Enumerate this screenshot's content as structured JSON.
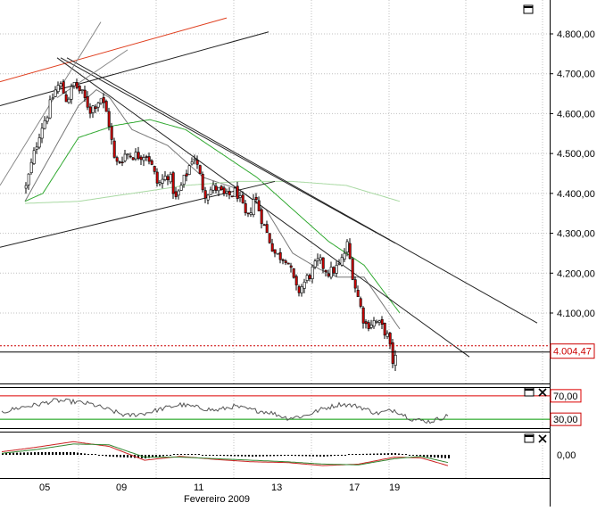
{
  "theme": {
    "grid": "#c0c0c0",
    "axis": "#000000",
    "up": "#ffffff",
    "down": "#cc0000",
    "wick": "#000000",
    "ma_fast": "#777777",
    "ma_mid": "#33aa33",
    "ma_slow": "#a9d9a3",
    "trend": "#000000",
    "trend_red": "#e04020",
    "price_line": "#cc0000",
    "rsi_line": "#555555",
    "ob_line": "#dd0000",
    "os_line": "#009900"
  },
  "chart_data": [
    {
      "type": "candlestick",
      "panel": "price",
      "xlabel": "Fevereiro 2009",
      "x_tick_labels": [
        "05",
        "09",
        "11",
        "13",
        "17",
        "19"
      ],
      "ylim": [
        4015,
        4840
      ],
      "y_tick_labels": [
        "4.100,00",
        "4.200,00",
        "4.300,00",
        "4.400,00",
        "4.500,00",
        "4.600,00",
        "4.700,00",
        "4.800,00"
      ],
      "y_ticks": [
        4100,
        4200,
        4300,
        4400,
        4500,
        4600,
        4700,
        4800
      ],
      "grid": true,
      "last_price": 4004.47,
      "last_price_label": "4.004,47",
      "close_anchors": [
        [
          0,
          4415
        ],
        [
          8,
          4490
        ],
        [
          16,
          4560
        ],
        [
          24,
          4600
        ],
        [
          32,
          4655
        ],
        [
          38,
          4675
        ],
        [
          46,
          4632
        ],
        [
          54,
          4675
        ],
        [
          62,
          4652
        ],
        [
          72,
          4610
        ],
        [
          84,
          4640
        ],
        [
          92,
          4590
        ],
        [
          100,
          4470
        ],
        [
          112,
          4500
        ],
        [
          124,
          4495
        ],
        [
          136,
          4500
        ],
        [
          148,
          4420
        ],
        [
          160,
          4450
        ],
        [
          168,
          4385
        ],
        [
          180,
          4450
        ],
        [
          188,
          4500
        ],
        [
          200,
          4400
        ],
        [
          212,
          4415
        ],
        [
          224,
          4390
        ],
        [
          236,
          4405
        ],
        [
          248,
          4330
        ],
        [
          256,
          4395
        ],
        [
          268,
          4310
        ],
        [
          280,
          4245
        ],
        [
          292,
          4240
        ],
        [
          304,
          4150
        ],
        [
          316,
          4190
        ],
        [
          328,
          4230
        ],
        [
          340,
          4200
        ],
        [
          352,
          4220
        ],
        [
          360,
          4270
        ],
        [
          368,
          4175
        ],
        [
          380,
          4070
        ],
        [
          392,
          4080
        ],
        [
          404,
          4050
        ],
        [
          412,
          3970
        ],
        [
          416,
          4004
        ]
      ],
      "moving_averages": [
        {
          "period_class": "fast",
          "anchors": [
            [
              0,
              4380
            ],
            [
              30,
              4500
            ],
            [
              60,
              4620
            ],
            [
              80,
              4660
            ],
            [
              95,
              4640
            ],
            [
              120,
              4560
            ],
            [
              160,
              4520
            ],
            [
              200,
              4440
            ],
            [
              240,
              4410
            ],
            [
              270,
              4360
            ],
            [
              300,
              4250
            ],
            [
              330,
              4210
            ],
            [
              350,
              4190
            ],
            [
              380,
              4190
            ],
            [
              420,
              4060
            ]
          ]
        },
        {
          "period_class": "mid",
          "anchors": [
            [
              0,
              4380
            ],
            [
              20,
              4400
            ],
            [
              60,
              4540
            ],
            [
              100,
              4570
            ],
            [
              140,
              4585
            ],
            [
              180,
              4560
            ],
            [
              220,
              4500
            ],
            [
              260,
              4440
            ],
            [
              300,
              4360
            ],
            [
              340,
              4280
            ],
            [
              380,
              4220
            ],
            [
              420,
              4100
            ]
          ]
        },
        {
          "period_class": "slow",
          "anchors": [
            [
              0,
              4375
            ],
            [
              60,
              4380
            ],
            [
              120,
              4400
            ],
            [
              180,
              4420
            ],
            [
              240,
              4430
            ],
            [
              300,
              4430
            ],
            [
              360,
              4420
            ],
            [
              420,
              4380
            ]
          ]
        }
      ],
      "trendlines": [
        {
          "color": "red",
          "from": [
            -28,
            4680
          ],
          "to": [
            226,
            4840
          ]
        },
        {
          "color": "black",
          "from": [
            -28,
            4620
          ],
          "to": [
            273,
            4805
          ]
        },
        {
          "color": "black",
          "from": [
            -28,
            4265
          ],
          "to": [
            280,
            4430
          ]
        },
        {
          "color": "black",
          "from": [
            47,
            4740
          ],
          "to": [
            574,
            4075
          ]
        },
        {
          "color": "black",
          "from": [
            36,
            4740
          ],
          "to": [
            498,
            3990
          ]
        },
        {
          "color": "black",
          "from": [
            40,
            4740
          ],
          "to": [
            415,
            4275
          ]
        },
        {
          "color": "grey",
          "from": [
            -28,
            4420
          ],
          "to": [
            85,
            4830
          ]
        },
        {
          "color": "grey",
          "from": [
            36,
            4640
          ],
          "to": [
            115,
            4760
          ]
        }
      ]
    },
    {
      "type": "line",
      "panel": "oscillator",
      "yticks": [
        30,
        70
      ],
      "y_tick_labels": [
        "30,00",
        "70,00"
      ],
      "ylim": [
        15,
        85
      ],
      "anchors": [
        [
          0,
          42
        ],
        [
          20,
          50
        ],
        [
          40,
          55
        ],
        [
          60,
          62
        ],
        [
          80,
          60
        ],
        [
          100,
          56
        ],
        [
          120,
          46
        ],
        [
          140,
          36
        ],
        [
          160,
          40
        ],
        [
          180,
          48
        ],
        [
          200,
          55
        ],
        [
          220,
          50
        ],
        [
          240,
          45
        ],
        [
          260,
          52
        ],
        [
          280,
          46
        ],
        [
          300,
          42
        ],
        [
          320,
          32
        ],
        [
          340,
          36
        ],
        [
          360,
          48
        ],
        [
          380,
          56
        ],
        [
          400,
          52
        ],
        [
          420,
          40
        ],
        [
          440,
          46
        ],
        [
          460,
          30
        ],
        [
          480,
          26
        ],
        [
          500,
          36
        ]
      ]
    },
    {
      "type": "line",
      "panel": "macd",
      "yticks": [
        0
      ],
      "y_tick_labels": [
        "0,00"
      ],
      "ylim": [
        -60,
        60
      ],
      "series": [
        {
          "key": "macd",
          "anchors": [
            [
              0,
              8
            ],
            [
              40,
              20
            ],
            [
              80,
              34
            ],
            [
              120,
              22
            ],
            [
              160,
              -14
            ],
            [
              200,
              -4
            ],
            [
              240,
              -12
            ],
            [
              280,
              -18
            ],
            [
              320,
              -20
            ],
            [
              360,
              -28
            ],
            [
              400,
              -24
            ],
            [
              440,
              -6
            ],
            [
              470,
              -8
            ],
            [
              500,
              -28
            ]
          ]
        },
        {
          "key": "signal",
          "anchors": [
            [
              0,
              4
            ],
            [
              40,
              14
            ],
            [
              80,
              28
            ],
            [
              120,
              26
            ],
            [
              160,
              -6
            ],
            [
              200,
              -6
            ],
            [
              240,
              -10
            ],
            [
              280,
              -14
            ],
            [
              320,
              -18
            ],
            [
              360,
              -24
            ],
            [
              400,
              -26
            ],
            [
              440,
              -10
            ],
            [
              470,
              -4
            ],
            [
              500,
              -20
            ]
          ]
        }
      ]
    }
  ]
}
